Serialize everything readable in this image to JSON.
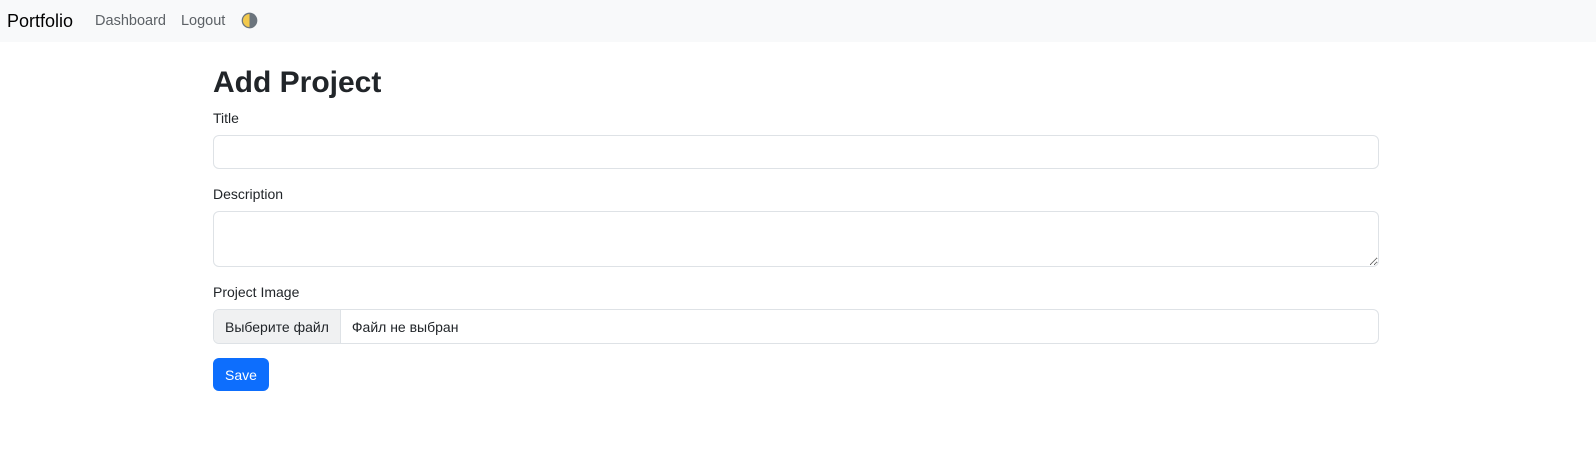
{
  "navbar": {
    "brand": "Portfolio",
    "links": [
      {
        "label": "Dashboard"
      },
      {
        "label": "Logout"
      }
    ],
    "theme_icon": "theme-toggle-icon"
  },
  "page": {
    "title": "Add Project"
  },
  "form": {
    "title_label": "Title",
    "title_value": "",
    "description_label": "Description",
    "description_value": "",
    "image_label": "Project Image",
    "file_button_label": "Выберите файл",
    "file_status": "Файл не выбран",
    "save_label": "Save"
  },
  "colors": {
    "navbar_bg": "#f8f9fa",
    "primary": "#0d6efd",
    "border": "#dee2e6",
    "text": "#212529"
  }
}
